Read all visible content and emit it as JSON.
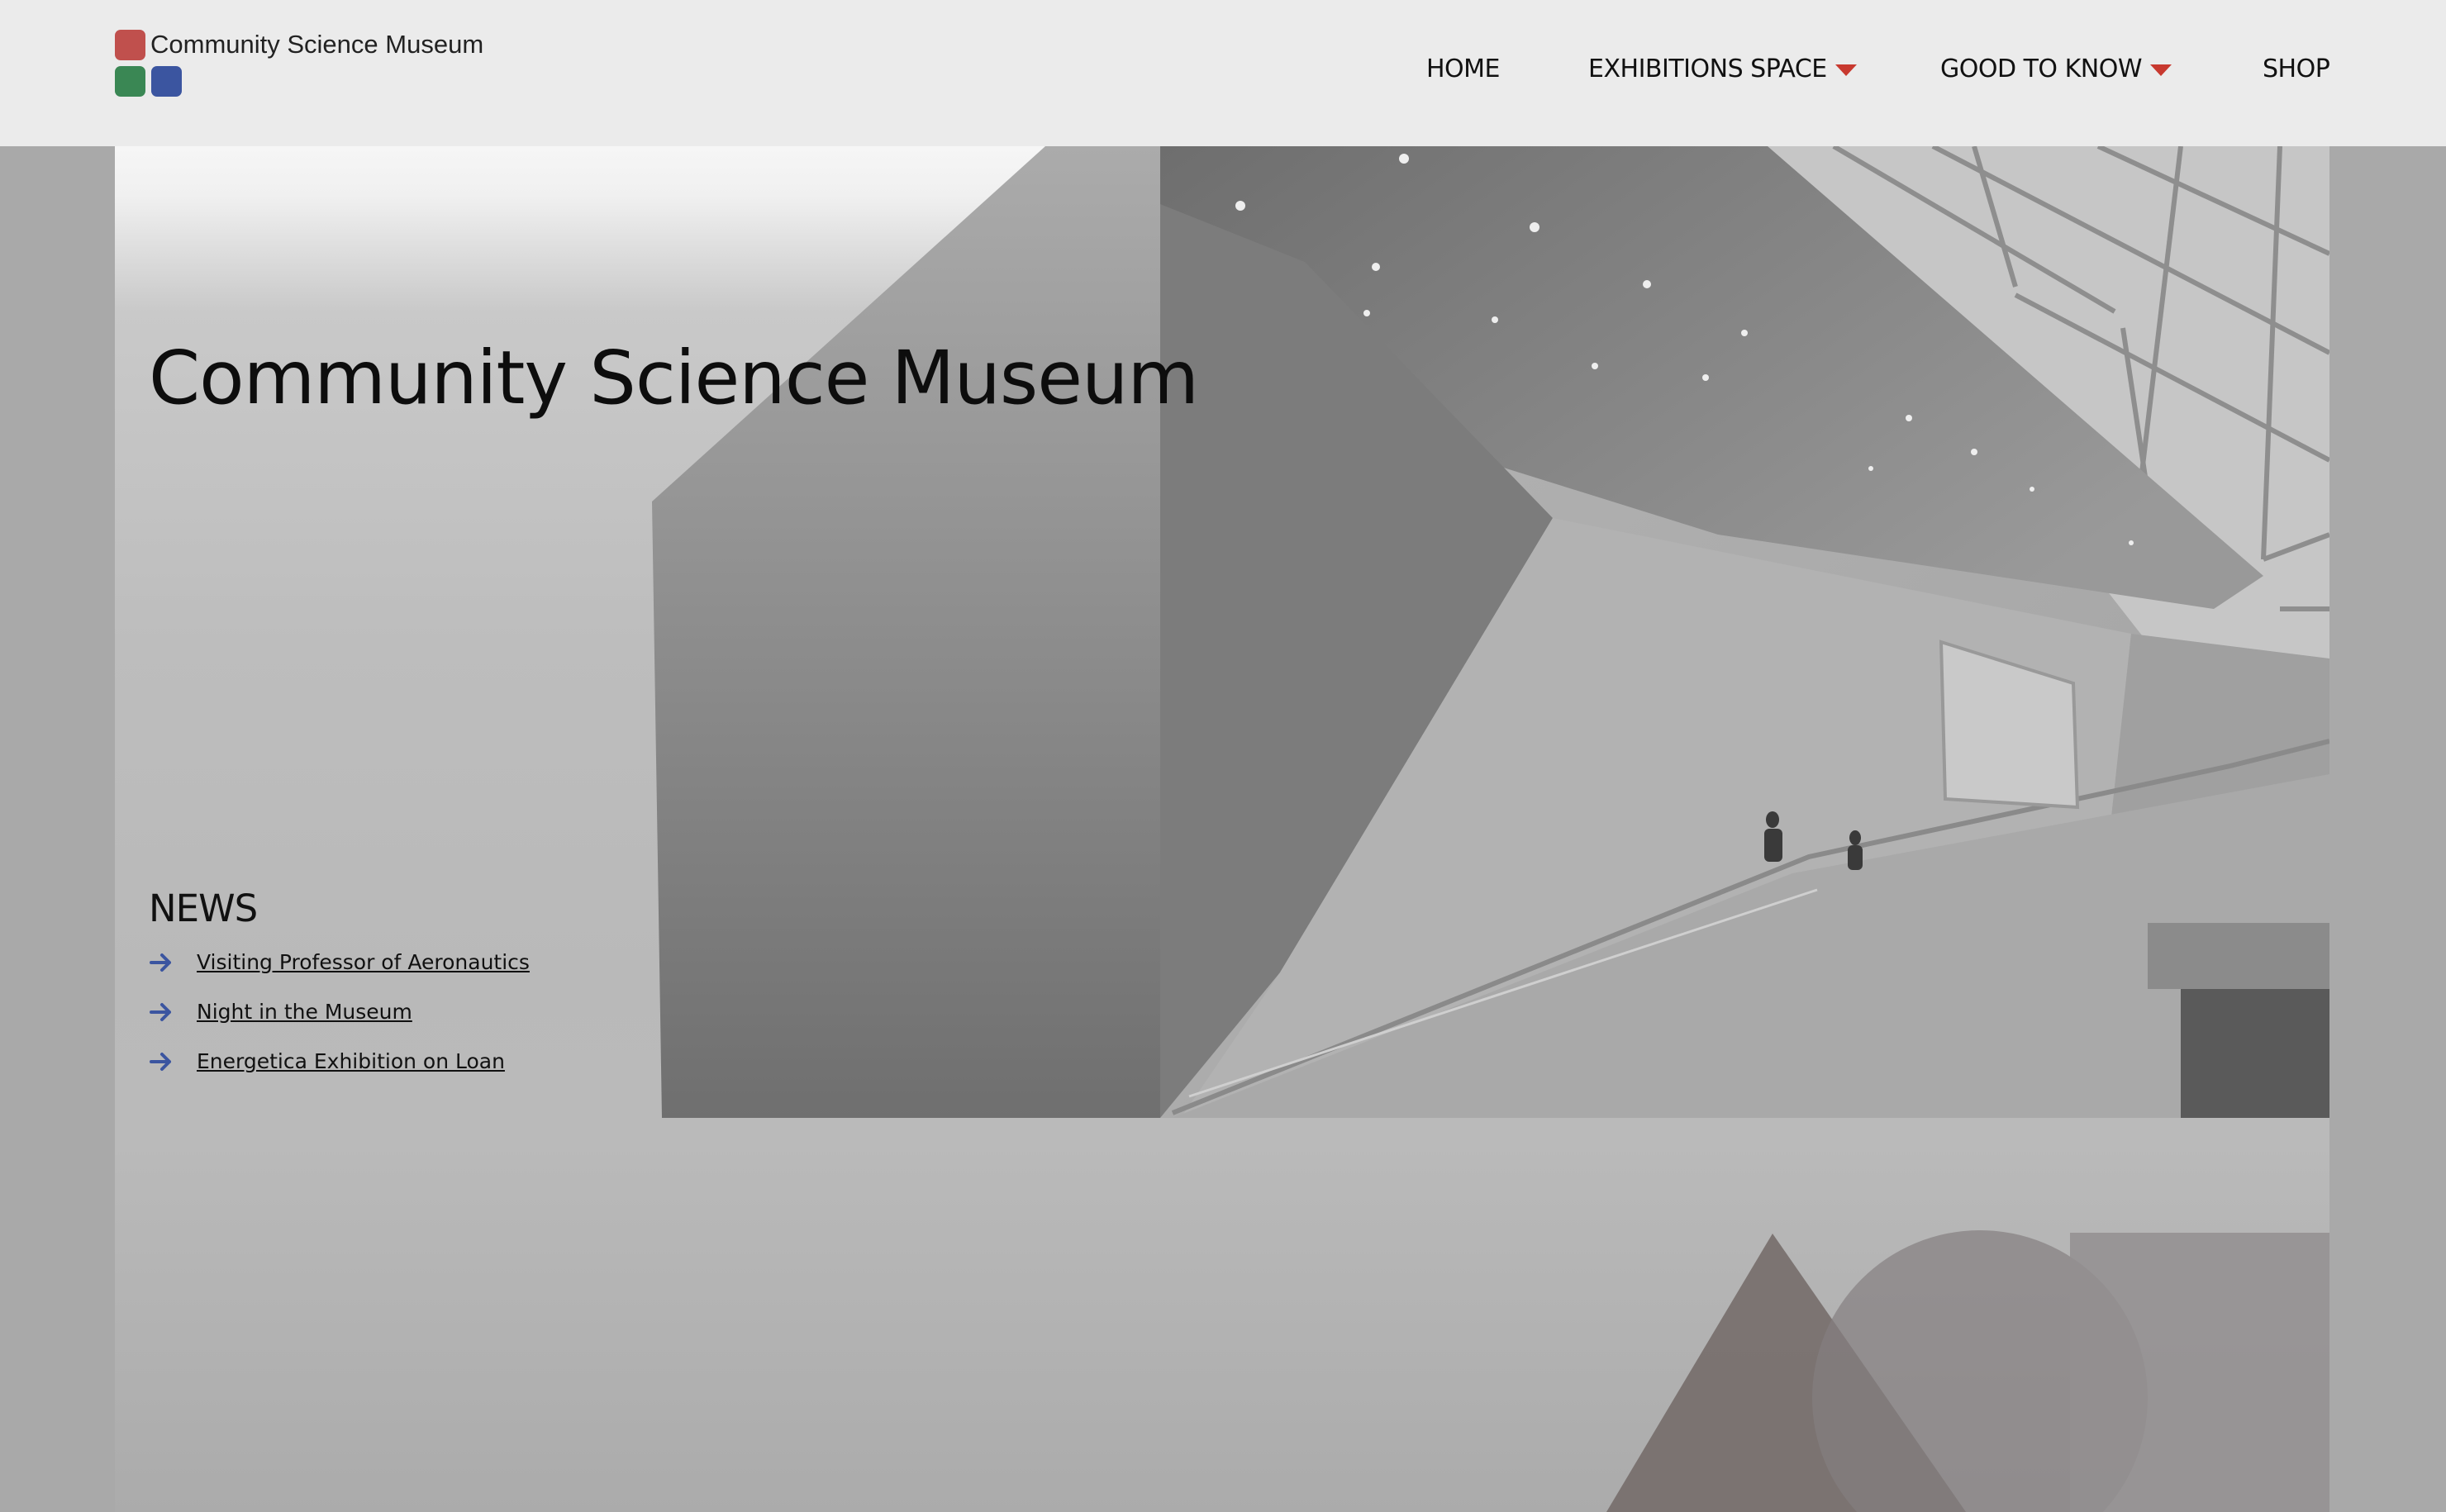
{
  "header": {
    "logo_text": "Community Science Museum",
    "nav": [
      {
        "label": "HOME",
        "has_dropdown": false
      },
      {
        "label": "EXHIBITIONS SPACE",
        "has_dropdown": true
      },
      {
        "label": "GOOD TO KNOW",
        "has_dropdown": true
      },
      {
        "label": "SHOP",
        "has_dropdown": false
      }
    ]
  },
  "hero": {
    "title": "Community Science Museum",
    "image": "museum-atrium-photo"
  },
  "news": {
    "heading": "NEWS",
    "items": [
      {
        "label": "Visiting Professor of Aeronautics"
      },
      {
        "label": "Night in the Museum"
      },
      {
        "label": "Energetica Exhibition on Loan"
      }
    ]
  },
  "colors": {
    "logo_red": "#c0504d",
    "logo_green": "#3a8754",
    "logo_blue": "#3b55a0",
    "caret": "#c8392f",
    "news_arrow": "#3b55a0"
  }
}
